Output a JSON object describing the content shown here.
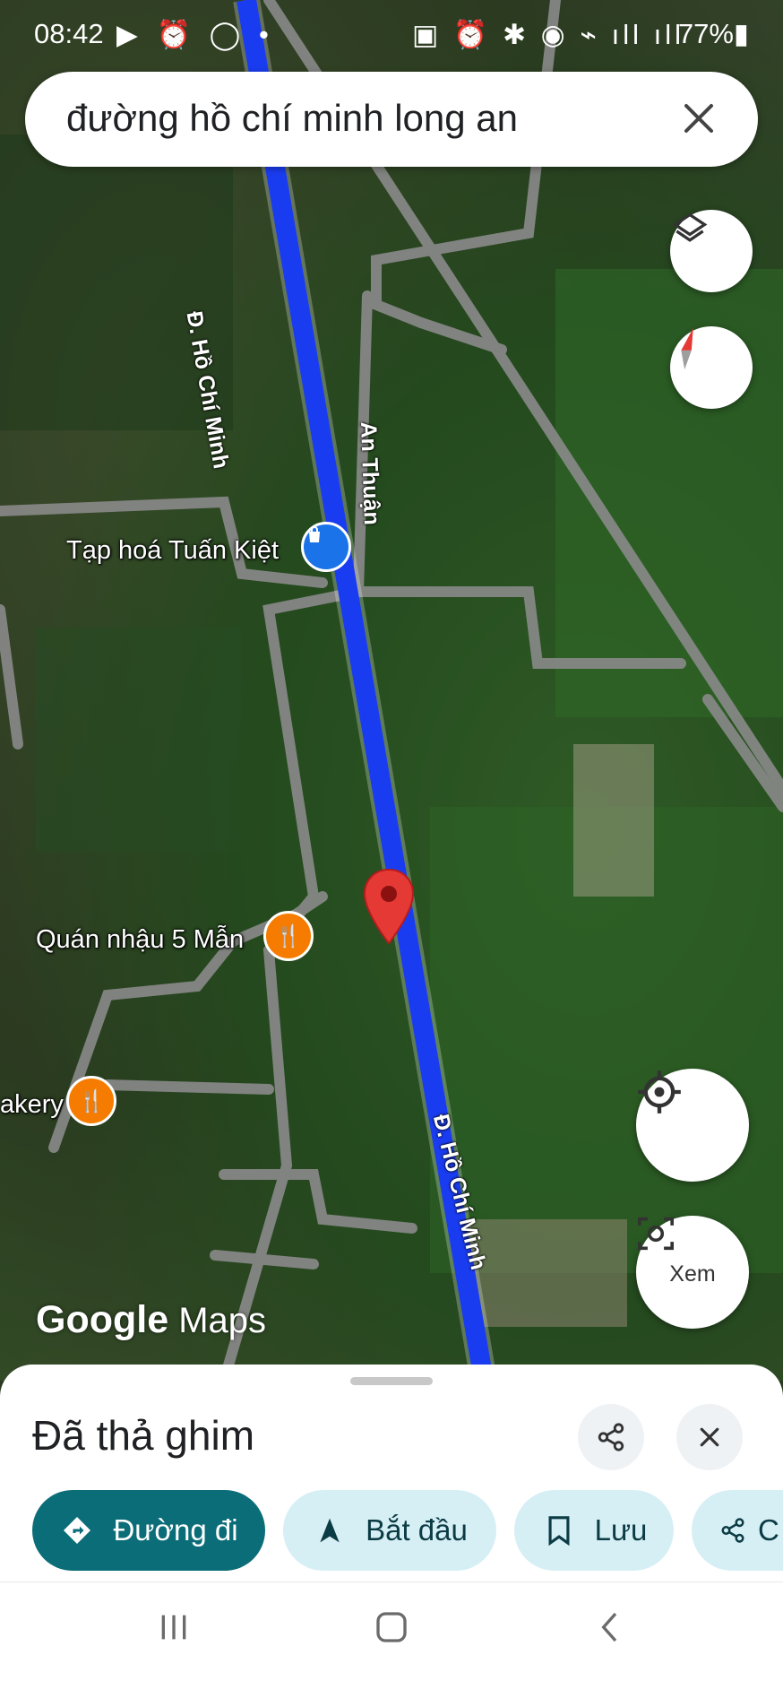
{
  "status_bar": {
    "time": "08:42",
    "left_icons": "▶ ⏰ ◯ •",
    "right_icons": "▣ ⏰ ✱ ◉ ⌁ ıll ıll",
    "battery": "77%▮"
  },
  "search": {
    "query": "đường hồ chí minh long an"
  },
  "map": {
    "road_labels": [
      "Đ. Hồ Chí Minh",
      "An Thuận",
      "Đ. Hồ Chí Minh"
    ],
    "places": [
      {
        "name": "Tạp hoá Tuấn Kiệt",
        "icon": "shopping-bag-icon",
        "color": "#1a73e8"
      },
      {
        "name": "Quán nhậu 5 Mẫn",
        "icon": "restaurant-icon",
        "color": "#f57c00"
      },
      {
        "name": "akery",
        "icon": "restaurant-icon",
        "color": "#f57c00"
      }
    ],
    "logo": {
      "brand": "Google",
      "product": "Maps"
    },
    "xem_label": "Xem"
  },
  "sheet": {
    "title": "Đã thả ghim",
    "chips": [
      {
        "label": "Đường đi",
        "icon": "directions-icon"
      },
      {
        "label": "Bắt đầu",
        "icon": "navigation-arrow-icon"
      },
      {
        "label": "Lưu",
        "icon": "bookmark-icon"
      },
      {
        "label": "C",
        "icon": "share-icon"
      }
    ]
  },
  "colors": {
    "route": "#1a3cf0",
    "accent": "#0b6d78",
    "chip_bg": "#d6eff5",
    "pin": "#e53935"
  }
}
